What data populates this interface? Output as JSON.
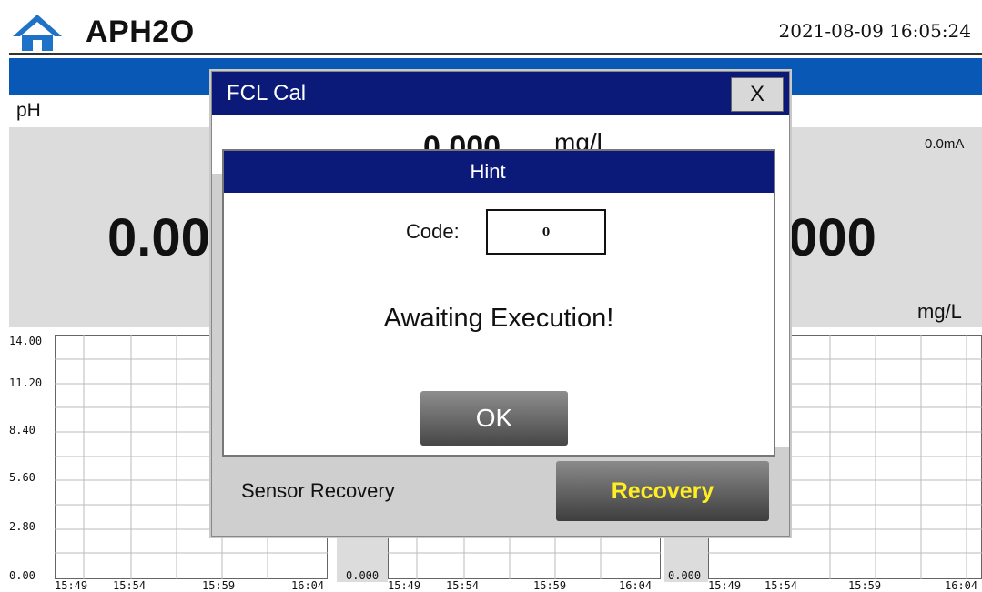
{
  "header": {
    "title": "APH2O",
    "datetime": "2021-08-09 16:05:24",
    "home_icon": "home-icon"
  },
  "panels": {
    "left": {
      "label": "pH",
      "value": "0.00"
    },
    "right": {
      "value": ".000",
      "current": "0.0mA",
      "unit": "mg/L"
    }
  },
  "charts": {
    "left": {
      "y_ticks": [
        "14.00",
        "11.20",
        "8.40",
        "5.60",
        "2.80",
        "0.00"
      ],
      "x_ticks": [
        "15:49",
        "15:54",
        "15:59",
        "16:04"
      ]
    },
    "middle": {
      "y_min": "0.000",
      "x_ticks": [
        "15:49",
        "15:54",
        "15:59",
        "16:04"
      ]
    },
    "right": {
      "y_min": "0.000",
      "x_ticks": [
        "15:49",
        "15:54",
        "15:59",
        "16:04"
      ]
    }
  },
  "fcl_dialog": {
    "title": "FCL Cal",
    "close_label": "X",
    "value": "0.000",
    "unit": "mg/l",
    "sensor_recovery_label": "Sensor Recovery",
    "recovery_button": "Recovery"
  },
  "hint_dialog": {
    "title": "Hint",
    "code_label": "Code:",
    "code_value": "0",
    "message": "Awaiting Execution!",
    "ok_button": "OK"
  },
  "colors": {
    "accent_blue": "#0a58b6",
    "title_bar": "#0b1a78",
    "recovery_text": "#ffee22"
  }
}
